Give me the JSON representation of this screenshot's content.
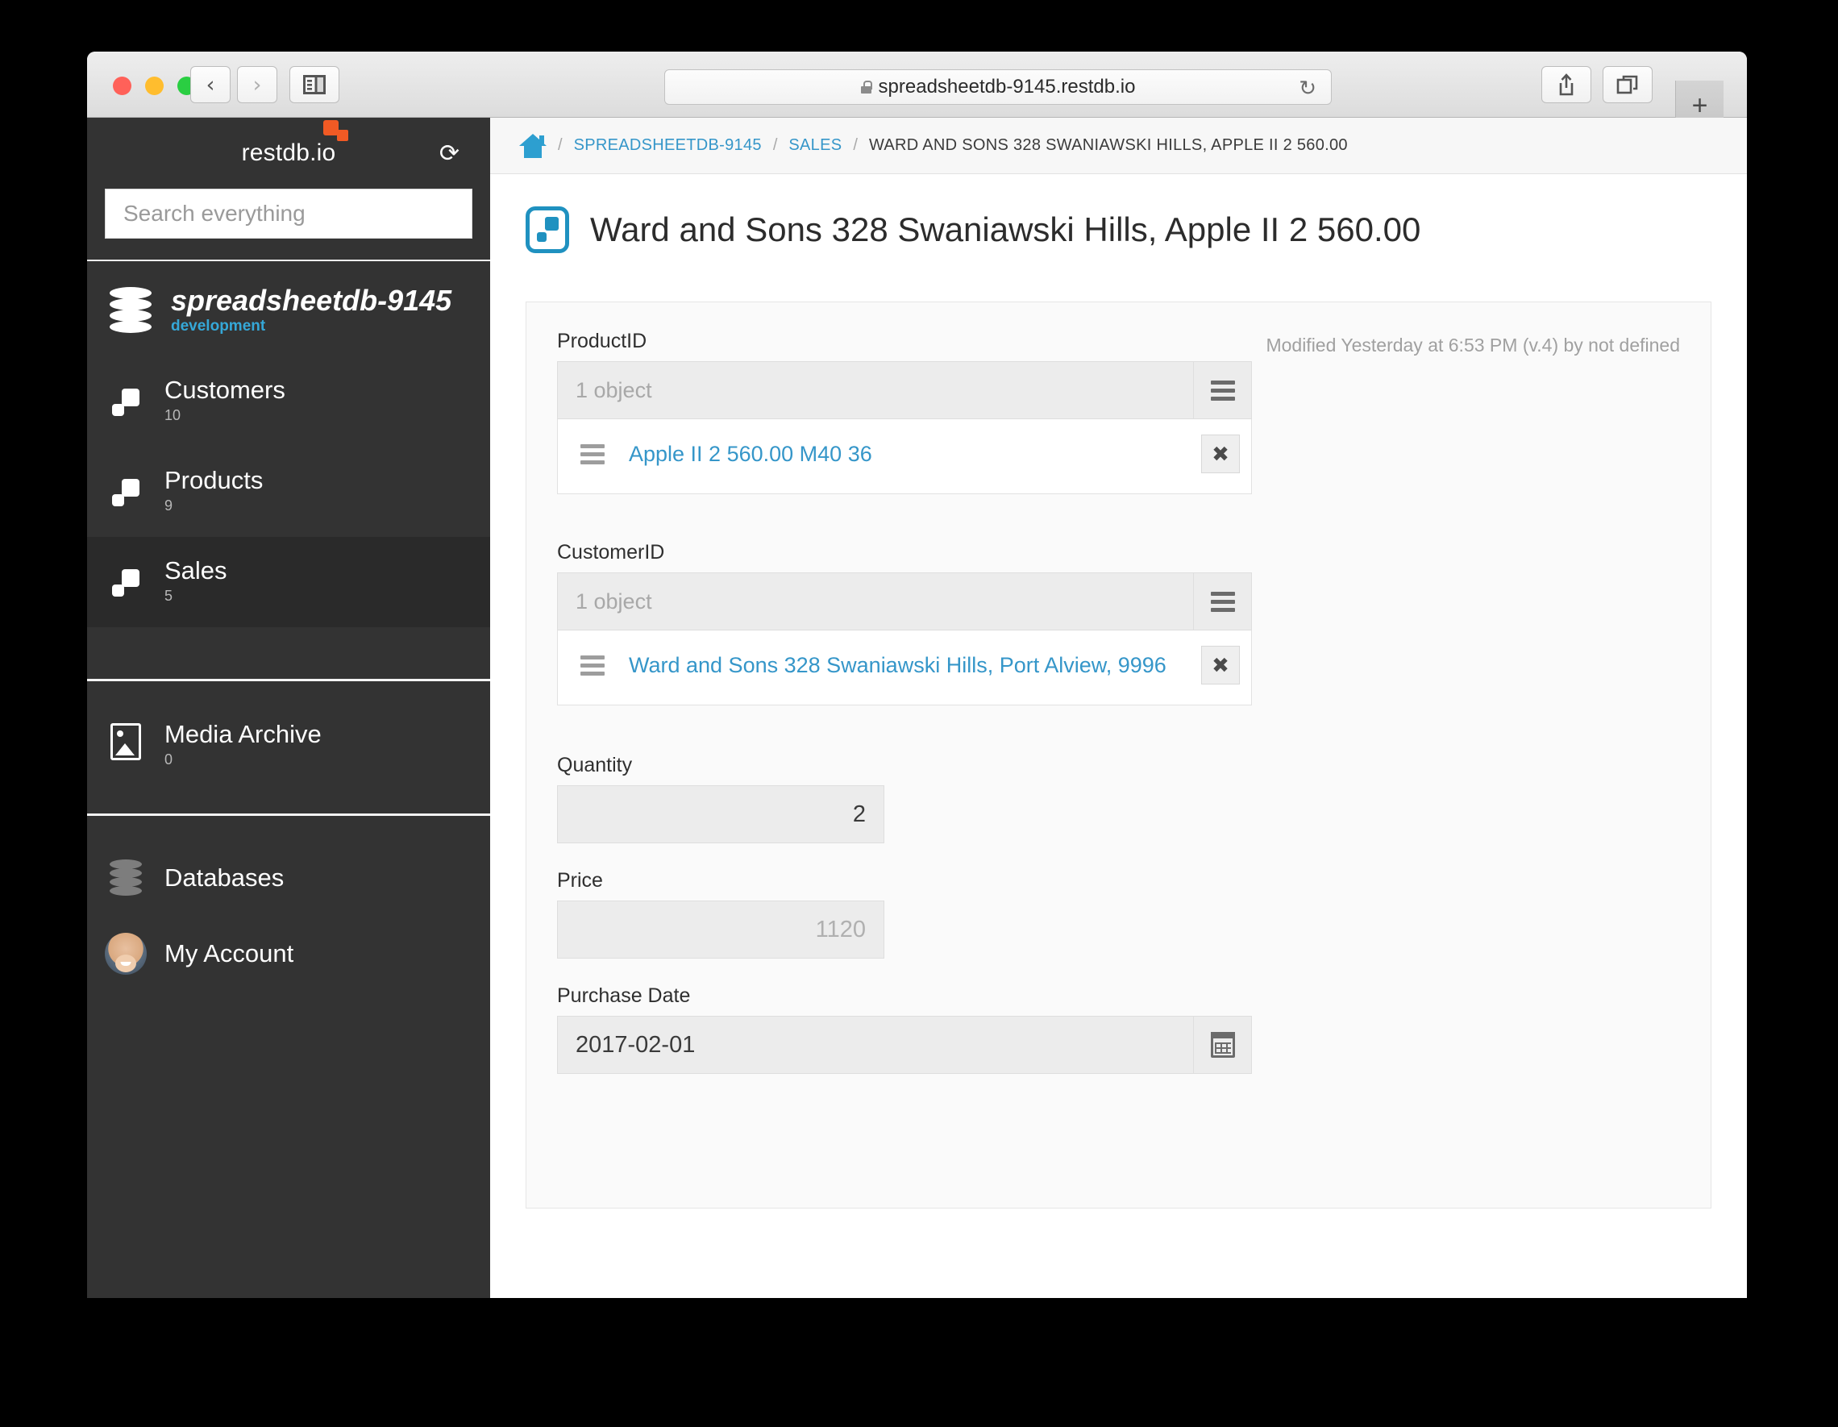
{
  "browser": {
    "url": "spreadsheetdb-9145.restdb.io",
    "back_icon": "chevron-left-icon",
    "forward_icon": "chevron-right-icon",
    "sidebar_icon": "sidebar-toggle-icon",
    "reload_glyph": "↻",
    "share_icon": "share-icon",
    "tabs_icon": "show-tabs-icon",
    "new_tab_glyph": "+"
  },
  "sidebar": {
    "brand": "restdb.io",
    "refresh_glyph": "⟳",
    "search": {
      "placeholder": "Search everything",
      "value": ""
    },
    "database": {
      "name": "spreadsheetdb-9145",
      "env": "development"
    },
    "collections": [
      {
        "label": "Customers",
        "count": "10",
        "active": false
      },
      {
        "label": "Products",
        "count": "9",
        "active": false
      },
      {
        "label": "Sales",
        "count": "5",
        "active": true
      }
    ],
    "media": {
      "label": "Media Archive",
      "count": "0"
    },
    "bottom": [
      {
        "label": "Databases"
      },
      {
        "label": "My Account"
      }
    ]
  },
  "breadcrumb": {
    "home_icon": "home-icon",
    "sep": "/",
    "items": [
      "SPREADSHEETDB-9145",
      "SALES",
      "WARD AND SONS 328 SWANIAWSKI HILLS, APPLE II 2 560.00"
    ]
  },
  "page": {
    "title": "Ward and Sons 328 Swaniawski Hills, Apple II 2 560.00",
    "modified": "Modified Yesterday at 6:53 PM (v.4) by not defined"
  },
  "form": {
    "product": {
      "label": "ProductID",
      "placeholder": "1 object",
      "item": "Apple II 2 560.00 M40 36",
      "remove_glyph": "✖"
    },
    "customer": {
      "label": "CustomerID",
      "placeholder": "1 object",
      "item": "Ward and Sons 328 Swaniawski Hills, Port Alview, 9996",
      "remove_glyph": "✖"
    },
    "quantity": {
      "label": "Quantity",
      "value": "2"
    },
    "price": {
      "label": "Price",
      "value": "1120"
    },
    "purchase_date": {
      "label": "Purchase Date",
      "value": "2017-02-01"
    }
  },
  "colors": {
    "accent_blue": "#3596c9",
    "brand_orange": "#f15a24",
    "sidebar_bg": "#333333",
    "env_blue": "#35a8d8"
  }
}
